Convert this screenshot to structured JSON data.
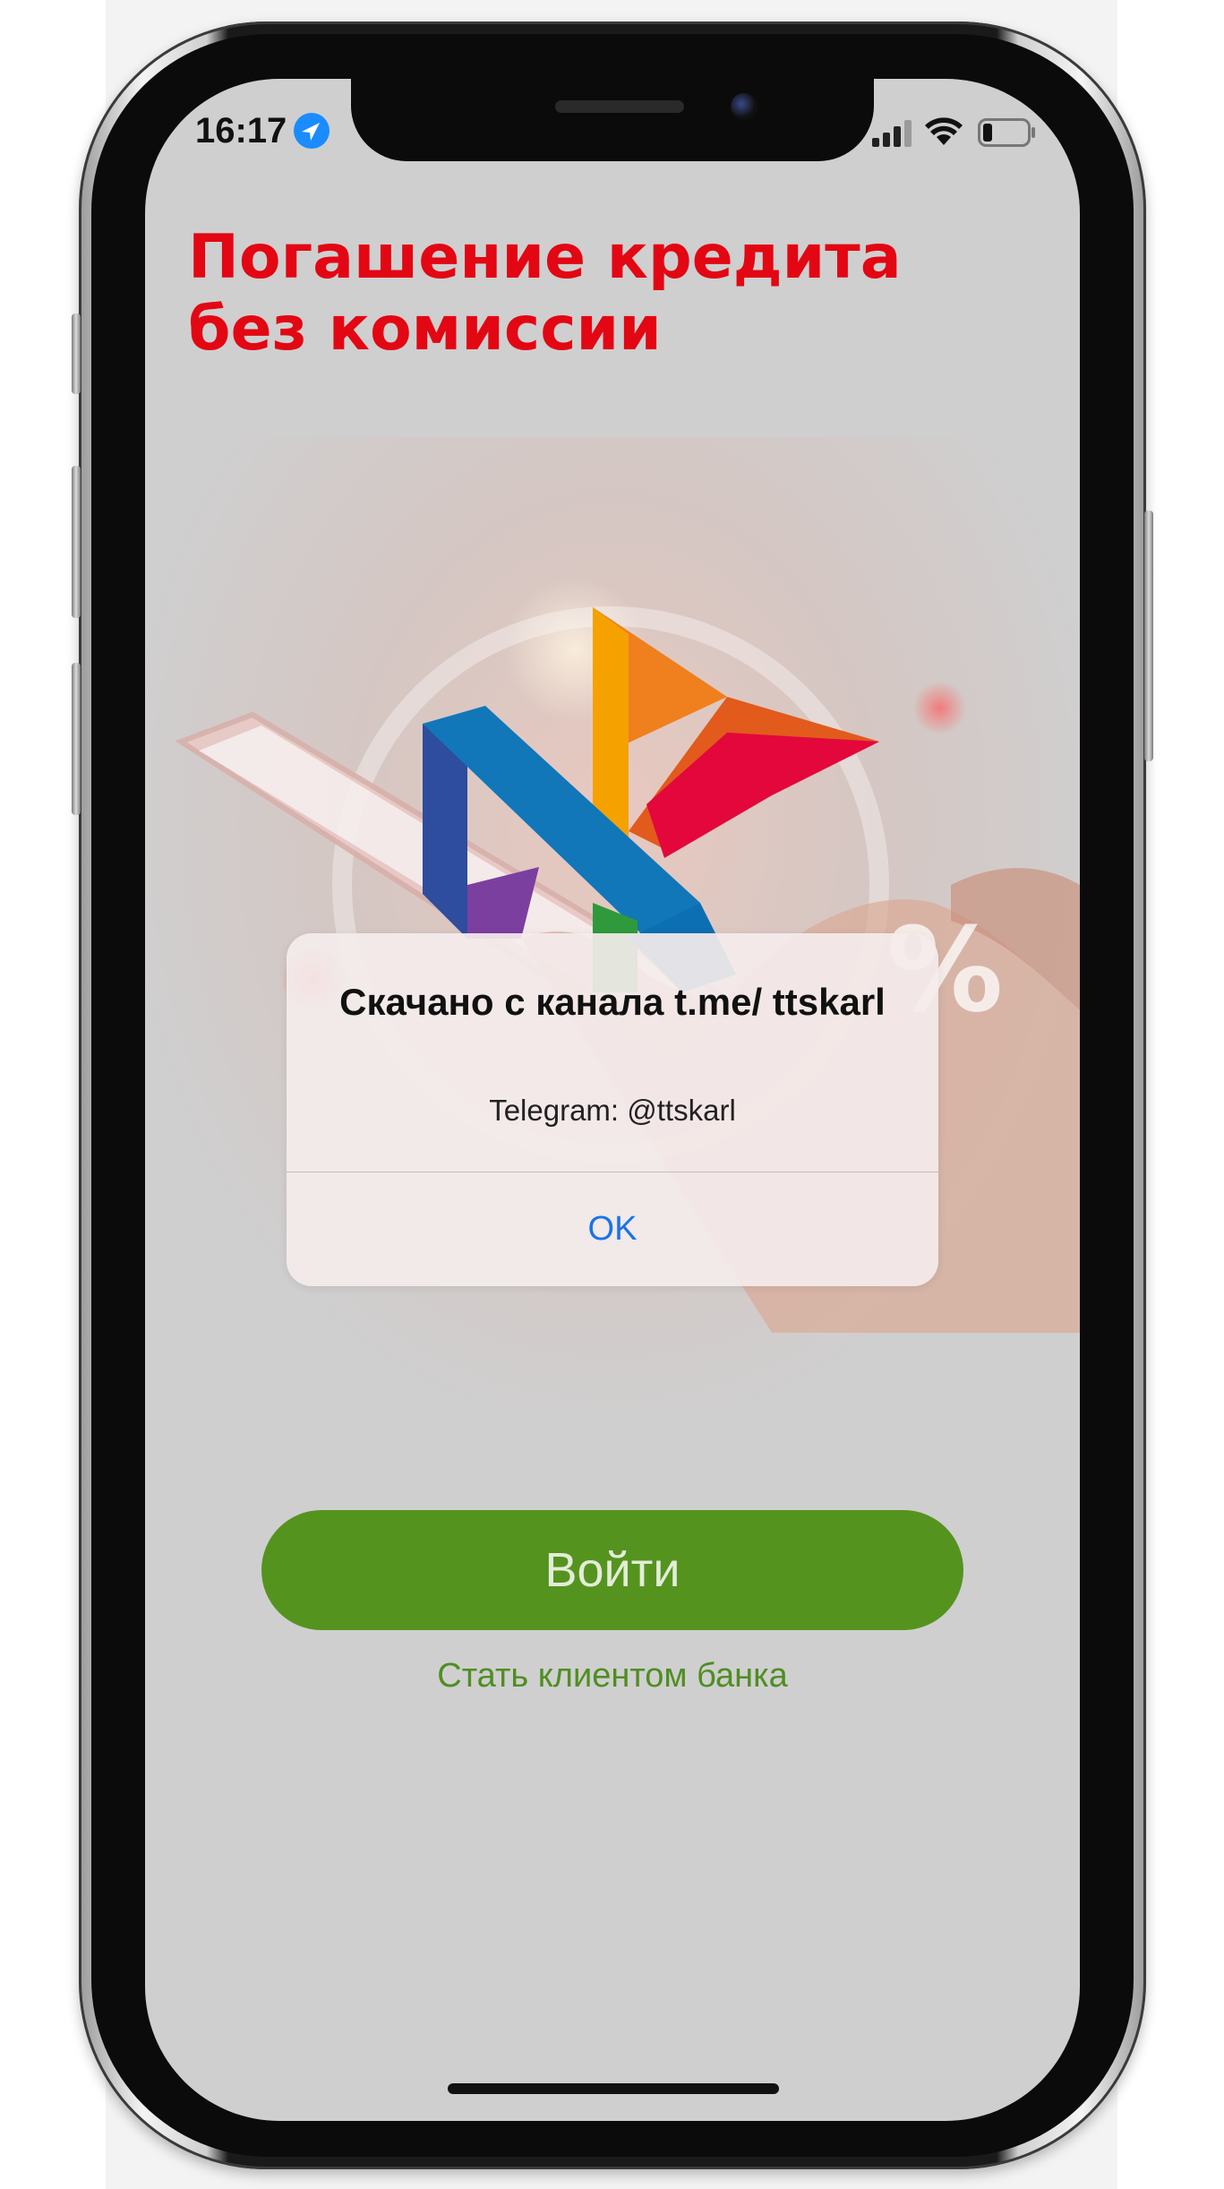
{
  "status_bar": {
    "time": "16:17",
    "icons": [
      "location-arrow-icon",
      "cellular-signal-icon",
      "wifi-icon",
      "battery-icon"
    ]
  },
  "banner": {
    "headline_line1": "Погашение кредита",
    "headline_line2": "без комиссии",
    "headline_color": "#e30613",
    "percent_sign": "%"
  },
  "alert": {
    "title": "Скачано с канала t.me/ ttskarl",
    "message": "Telegram: @ttskarl",
    "ok_label": "OK"
  },
  "login": {
    "login_label": "Войти",
    "become_client_label": "Стать клиентом банка",
    "accent_color": "#55931f"
  }
}
